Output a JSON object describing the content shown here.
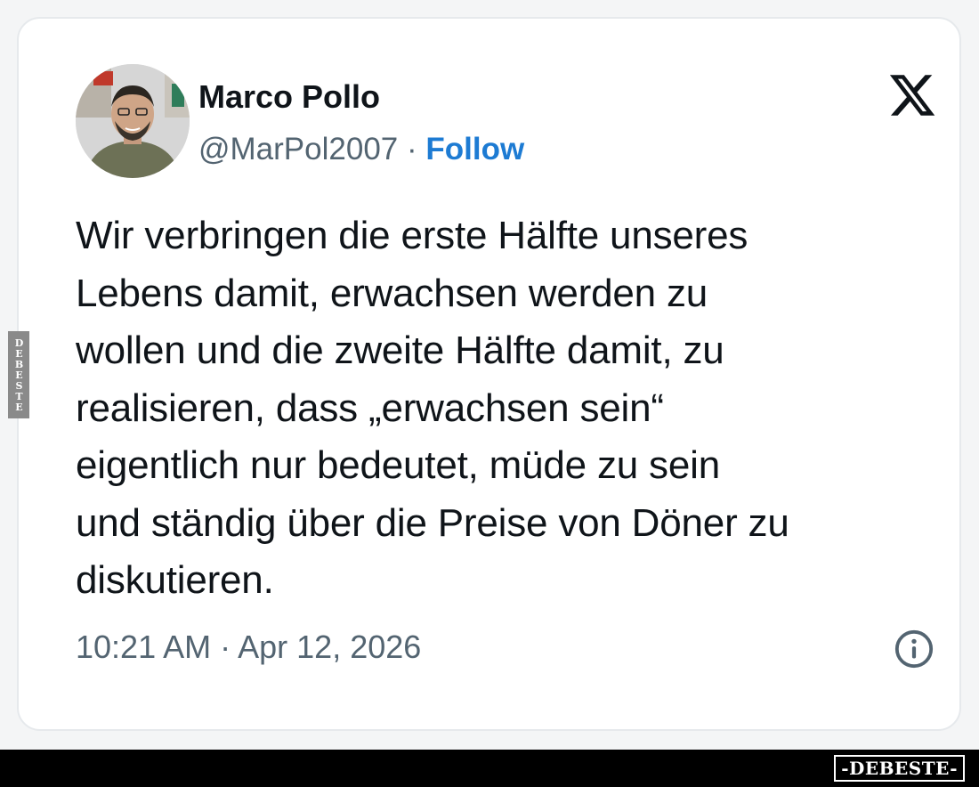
{
  "post": {
    "author": {
      "name": "Marco Pollo",
      "handle": "@MarPol2007",
      "separator": "·",
      "follow_label": "Follow"
    },
    "text_lines": [
      "Wir verbringen die erste Hälfte unseres",
      "Lebens damit, erwachsen werden zu",
      "wollen und die zweite Hälfte damit, zu",
      "realisieren, dass „erwachsen sein“",
      "eigentlich nur bedeutet, müde zu sein",
      "und ständig über die Preise von Döner zu",
      "diskutieren."
    ],
    "time": "10:21 AM",
    "separator": "·",
    "date": "Apr 12, 2026"
  },
  "watermarks": {
    "side": "DEBESTE",
    "bottom": "-DEBESTE-"
  },
  "icons": {
    "platform_logo": "x-logo-icon",
    "info": "info-icon",
    "avatar": "profile-photo"
  },
  "colors": {
    "follow": "#1d7bd3",
    "text": "#0f1419",
    "secondary": "#536471",
    "card_border": "#e6e9ec"
  }
}
